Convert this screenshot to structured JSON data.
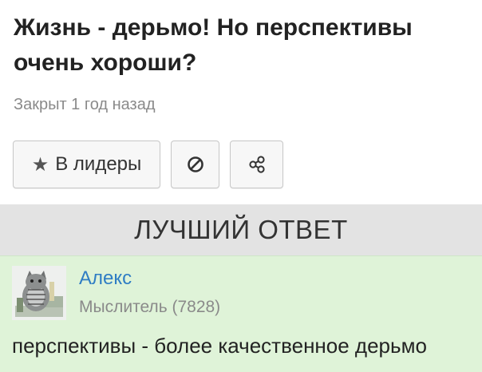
{
  "question": {
    "title": "Жизнь - дерьмо! Но перспективы очень хороши?",
    "status": "Закрыт 1 год назад"
  },
  "actions": {
    "leader_label": "В лидеры",
    "icons": [
      "star-icon",
      "block-icon",
      "share-icon"
    ]
  },
  "best_answer": {
    "header": "ЛУЧШИЙ ОТВЕТ",
    "author": "Алекс",
    "rank": "Мыслитель (7828)",
    "text": "перспективы - более качественное дерьмо"
  },
  "colors": {
    "answer_bg": "#dff3d8",
    "header_bg": "#e3e3e3",
    "link": "#2f7dc4",
    "muted": "#8a8a8a"
  }
}
